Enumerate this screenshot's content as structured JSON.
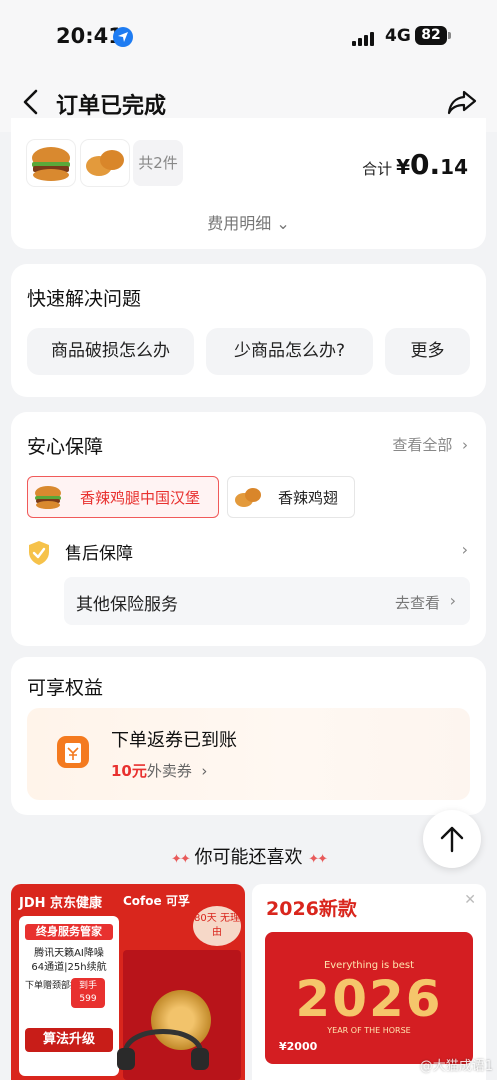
{
  "status_bar": {
    "time": "20:41",
    "network": "4G",
    "battery": "82"
  },
  "nav": {
    "title": "订单已完成"
  },
  "order_summary": {
    "more_items": "共2件",
    "total_label": "合计",
    "currency": "¥",
    "total_int": "0.",
    "total_dec": "14",
    "fee_detail": "费用明细"
  },
  "quick_solve": {
    "title": "快速解决问题",
    "options": [
      "商品破损怎么办",
      "少商品怎么办?",
      "更多"
    ]
  },
  "assurance": {
    "title": "安心保障",
    "view_all": "查看全部",
    "tags": [
      "香辣鸡腿中国汉堡",
      "香辣鸡翅"
    ],
    "after_sale": "售后保障",
    "insurance_label": "其他保险服务",
    "insurance_action": "去查看"
  },
  "benefits": {
    "title": "可享权益",
    "coupon_title": "下单返券已到账",
    "coupon_amount": "10元",
    "coupon_type": "外卖券"
  },
  "recommend": {
    "title": "你可能还喜欢"
  },
  "product_left": {
    "brand_1": "JDH 京东健康",
    "brand_2": "Cofoe 可孚",
    "badge": "终身服务管家",
    "line_1": "腾讯天籁AI降噪",
    "line_2": "64通道|25h续航",
    "line_3": "下单赠颈部按摩仪",
    "price_tag": "到手 599",
    "algo": "算法升级",
    "save_badge": "80天 无理由"
  },
  "product_right": {
    "title": "2026新款",
    "poster_small": "Everything is best",
    "poster_year": "2026",
    "poster_sub": "YEAR OF THE HORSE",
    "poster_price": "¥2000"
  },
  "watermark": "@大猫成语1",
  "colors": {
    "accent_red": "#e8312f",
    "ios_blue": "#1e7cf2",
    "page_bg": "#f2f3f5"
  }
}
